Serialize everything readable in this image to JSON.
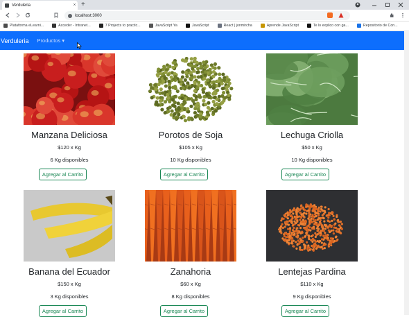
{
  "browser": {
    "tab_title": "Verduleria",
    "tab_close": "×",
    "new_tab": "+",
    "url": "localhost:3000",
    "bookmarks": [
      {
        "label": "Plataforma eLearni...",
        "color": "#4a4a4a"
      },
      {
        "label": "Acceder - Intranet...",
        "color": "#333333"
      },
      {
        "label": "7 Projects to practic...",
        "color": "#222222"
      },
      {
        "label": "JavaScript Ya",
        "color": "#555555"
      },
      {
        "label": "JavaScript",
        "color": "#111111"
      },
      {
        "label": "React | jonmircha",
        "color": "#6b7280"
      },
      {
        "label": "Aprende JavaScript",
        "color": "#c69500"
      },
      {
        "label": "Te lo explico con ga...",
        "color": "#111111"
      },
      {
        "label": "Repositorio de Con...",
        "color": "#1a73e8"
      }
    ]
  },
  "app": {
    "brand": "Verduleria",
    "menu": "Productos ▾"
  },
  "products": [
    {
      "name": "Manzana Deliciosa",
      "price": "$120 x Kg",
      "stock": "6 Kg disponibles",
      "button": "Agregar al Carrito",
      "image": "apples"
    },
    {
      "name": "Porotos de Soja",
      "price": "$105 x Kg",
      "stock": "10 Kg disponibles",
      "button": "Agregar al Carrito",
      "image": "soybeans"
    },
    {
      "name": "Lechuga Criolla",
      "price": "$50 x Kg",
      "stock": "10 Kg disponibles",
      "button": "Agregar al Carrito",
      "image": "lettuce"
    },
    {
      "name": "Banana del Ecuador",
      "price": "$150 x Kg",
      "stock": "3 Kg disponibles",
      "button": "Agregar al Carrito",
      "image": "bananas"
    },
    {
      "name": "Zanahoria",
      "price": "$60 x Kg",
      "stock": "8 Kg disponibles",
      "button": "Agregar al Carrito",
      "image": "carrots"
    },
    {
      "name": "Lentejas Pardina",
      "price": "$110 x Kg",
      "stock": "9 Kg disponibles",
      "button": "Agregar al Carrito",
      "image": "lentils"
    }
  ],
  "colors": {
    "navbar": "#0d6efd",
    "button_outline": "#198754"
  }
}
